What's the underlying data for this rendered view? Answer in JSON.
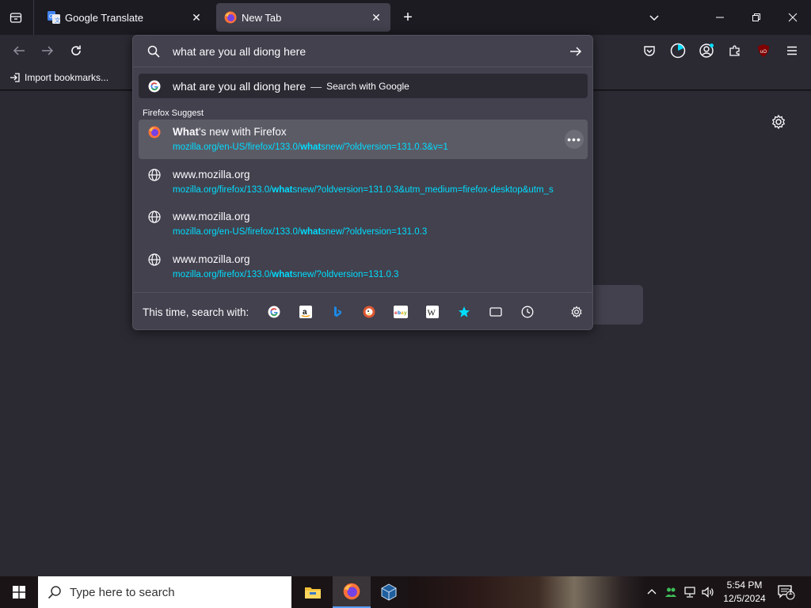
{
  "tabs": [
    {
      "title": "Google Translate",
      "icon": "google-translate-icon"
    },
    {
      "title": "New Tab",
      "icon": "firefox-icon"
    }
  ],
  "bookmarks": {
    "import_label": "Import bookmarks..."
  },
  "urlbar": {
    "value": "what are you all diong here",
    "heuristic": {
      "text": "what are you all diong here",
      "dash": "—",
      "action": "Search with Google"
    },
    "group_label": "Firefox Suggest",
    "results": [
      {
        "title_bold": "What",
        "title_rest": "'s new with Firefox",
        "url_pre": "mozilla.org/en-US/firefox/133.0/",
        "url_bold": "what",
        "url_post": "snew/?oldversion=131.0.3&v=1",
        "more": "•••"
      },
      {
        "title_bold": "",
        "title_rest": "www.mozilla.org",
        "url_pre": "mozilla.org/firefox/133.0/",
        "url_bold": "what",
        "url_post": "snew/?oldversion=131.0.3&utm_medium=firefox-desktop&utm_s"
      },
      {
        "title_bold": "",
        "title_rest": "www.mozilla.org",
        "url_pre": "mozilla.org/en-US/firefox/133.0/",
        "url_bold": "what",
        "url_post": "snew/?oldversion=131.0.3"
      },
      {
        "title_bold": "",
        "title_rest": "www.mozilla.org",
        "url_pre": "mozilla.org/firefox/133.0/",
        "url_bold": "what",
        "url_post": "snew/?oldversion=131.0.3"
      }
    ],
    "oneoff_label": "This time, search with:",
    "oneoff_engines": [
      "google",
      "amazon",
      "bing",
      "duckduckgo",
      "ebay",
      "wikipedia",
      "bookmarks",
      "tabs",
      "history",
      "settings"
    ]
  },
  "taskbar": {
    "search_placeholder": "Type here to search",
    "time": "5:54 PM",
    "date": "12/5/2024",
    "notification_count": "1"
  },
  "colors": {
    "accent": "#00ddff",
    "selected_row": "#5b5b66",
    "panel": "#42414d",
    "toolbar": "#2b2a33"
  }
}
